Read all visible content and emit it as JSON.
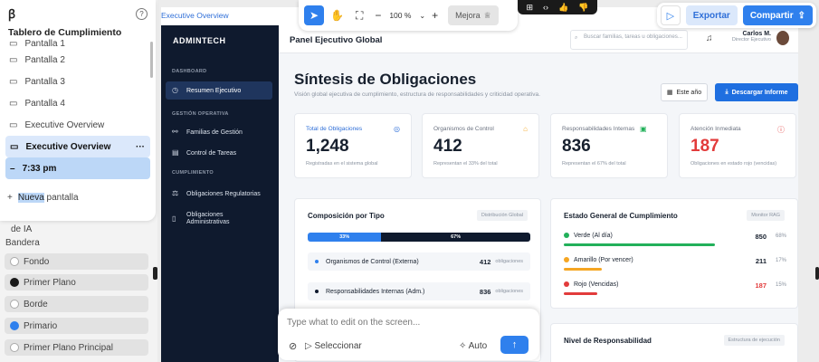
{
  "builder": {
    "title": "Tablero de Cumplimiento",
    "screens": [
      "Pantalla 1",
      "Pantalla 2",
      "Pantalla 3",
      "Pantalla 4",
      "Executive Overview",
      "Executive Overview"
    ],
    "more": "···",
    "version": "7:33 pm",
    "new_prefix": "+",
    "new_hl": "Nueva",
    "new_rest": "pantalla",
    "ia": "de IA",
    "flag_label": "Bandera",
    "colors": [
      {
        "label": "Fondo",
        "color": "#ffffff"
      },
      {
        "label": "Primer Plano",
        "color": "#1a1a1a"
      },
      {
        "label": "Borde",
        "color": "#ffffff"
      },
      {
        "label": "Primario",
        "color": "#2f80ed"
      },
      {
        "label": "Primer Plano Principal",
        "color": "#ffffff"
      }
    ]
  },
  "toolbar": {
    "zoom": "100 %",
    "minus": "−",
    "plus": "+",
    "mejora": "Mejora"
  },
  "topright": {
    "export": "Exportar",
    "share": "Compartir"
  },
  "app": {
    "tag": "Executive Overview",
    "brand": "ADMINTECH",
    "sections": {
      "dashboard": "DASHBOARD",
      "ops": "GESTIÓN OPERATIVA",
      "comp": "CUMPLIMIENTO"
    },
    "nav": [
      "Resumen Ejecutivo",
      "Familias de Gestión",
      "Control de Tareas",
      "Obligaciones Regulatorias",
      "Obligaciones Administrativas"
    ],
    "header_title": "Panel Ejecutivo Global",
    "search_placeholder": "Buscar familias, tareas u obligaciones...",
    "user_name": "Carlos M.",
    "user_role": "Director Ejecutivo",
    "h1": "Síntesis de Obligaciones",
    "subtitle": "Visión global ejecutiva de cumplimiento, estructura de responsabilidades y criticidad operativa.",
    "btn_year": "Este año",
    "btn_download": "Descargar Informe",
    "kpis": [
      {
        "label": "Total de Obligaciones",
        "value": "1,248",
        "desc": "Registradas en el sistema global",
        "color": "#2f6fd8",
        "icon": "◎"
      },
      {
        "label": "Organismos de Control",
        "value": "412",
        "desc": "Representan el 33% del total",
        "color": "#6b7280",
        "icon": "⌂"
      },
      {
        "label": "Responsabilidades Internas",
        "value": "836",
        "desc": "Representan el 67% del total",
        "color": "#6b7280",
        "icon": "▣"
      },
      {
        "label": "Atención Inmediata",
        "value": "187",
        "desc": "Obligaciones en estado rojo (vencidas)",
        "color": "#e23b3b",
        "icon": "ⓘ"
      }
    ],
    "comp": {
      "title": "Composición por Tipo",
      "chip": "Distribución Global",
      "seg1": "33%",
      "seg2": "67%",
      "seg1_pct": 33,
      "rows": [
        {
          "label": "Organismos de Control (Externa)",
          "value": "412",
          "unit": "obligaciones",
          "color": "#2f80ed"
        },
        {
          "label": "Responsabilidades Internas (Adm.)",
          "value": "836",
          "unit": "obligaciones",
          "color": "#0f1a2e"
        }
      ]
    },
    "status": {
      "title": "Estado General de Cumplimiento",
      "chip": "Monitor RAG",
      "rows": [
        {
          "label": "Verde (Al día)",
          "value": "850",
          "pct": "68%",
          "pct_num": 68,
          "color": "#22b05a"
        },
        {
          "label": "Amarillo (Por vencer)",
          "value": "211",
          "pct": "17%",
          "pct_num": 17,
          "color": "#f5a623"
        },
        {
          "label": "Rojo (Vencidas)",
          "value": "187",
          "pct": "15%",
          "pct_num": 15,
          "color": "#e23b3b"
        }
      ]
    },
    "resp": {
      "title": "Nivel de Responsabilidad",
      "chip": "Estructura de ejecución"
    }
  },
  "prompt": {
    "placeholder": "Type what to edit on the screen...",
    "select": "Seleccionar",
    "auto": "Auto"
  }
}
